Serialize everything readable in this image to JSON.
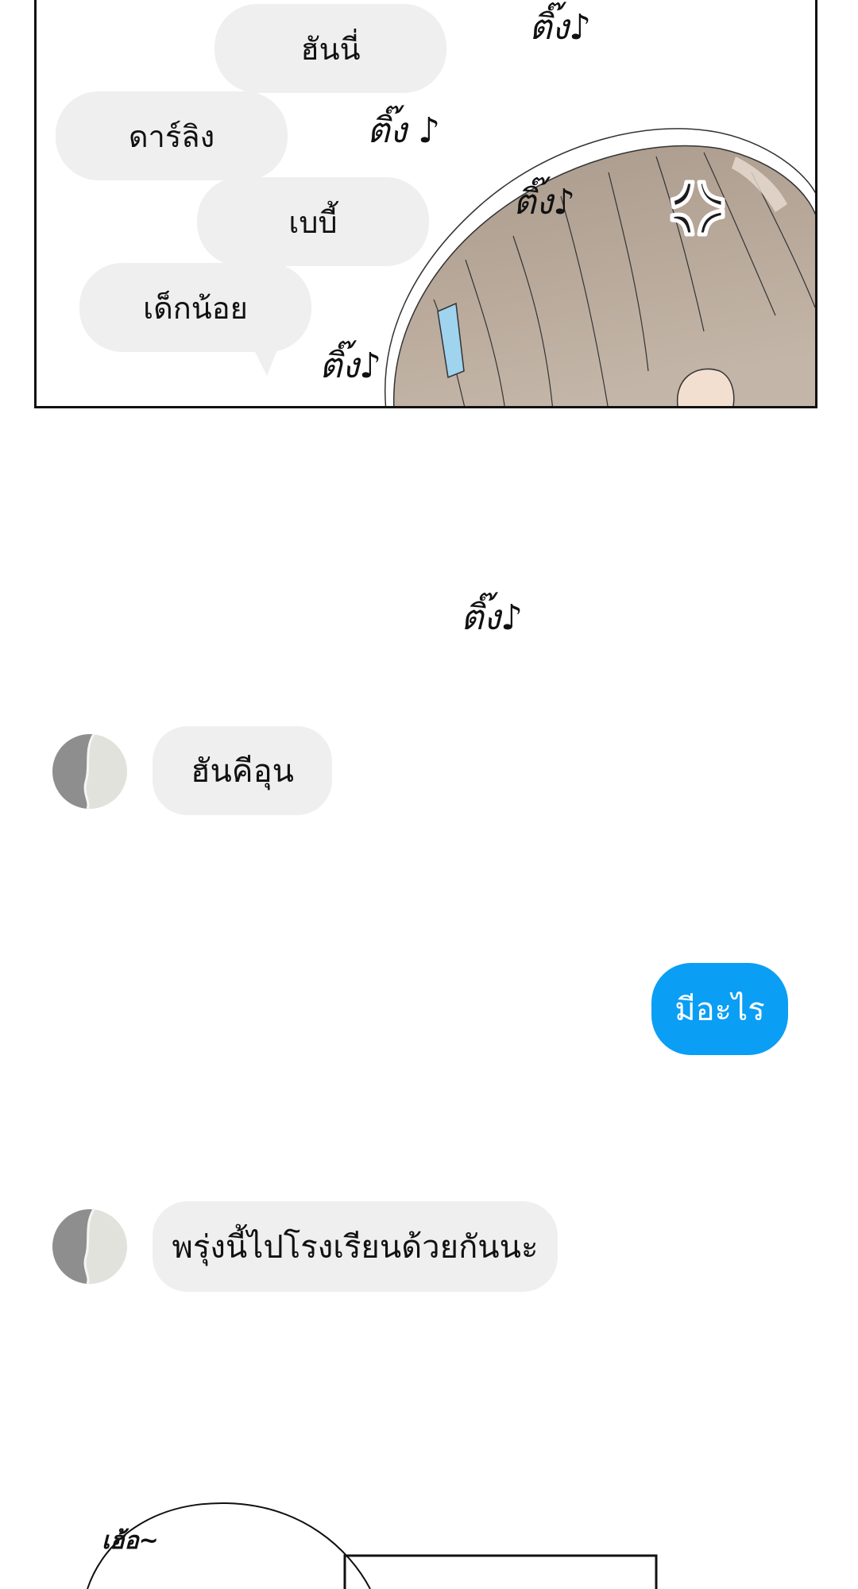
{
  "top_panel": {
    "bubbles": [
      {
        "text": "ฮันนี่"
      },
      {
        "text": "ดาร์ลิง"
      },
      {
        "text": "เบบี้"
      },
      {
        "text": "เด็กน้อย"
      }
    ],
    "sfx": [
      "ติ๊ง♪",
      "ติ๊ง ♪",
      "ติ๊ง♪",
      "ติ๊ง♪"
    ]
  },
  "between_sfx": "ติ๊ง♪",
  "chat": {
    "messages": [
      {
        "sender": "other",
        "text": "ฮันคีอุน"
      },
      {
        "sender": "me",
        "text": "มีอะไร"
      },
      {
        "sender": "other",
        "text": "พรุ่งนี้ไปโรงเรียนด้วยกันนะ"
      }
    ]
  },
  "bottom_panel": {
    "sfx": "เฮ้อ~"
  },
  "colors": {
    "bubble_gray": "#efefef",
    "my_bubble_blue": "#0a9ef5",
    "hair": "#b5a597"
  }
}
